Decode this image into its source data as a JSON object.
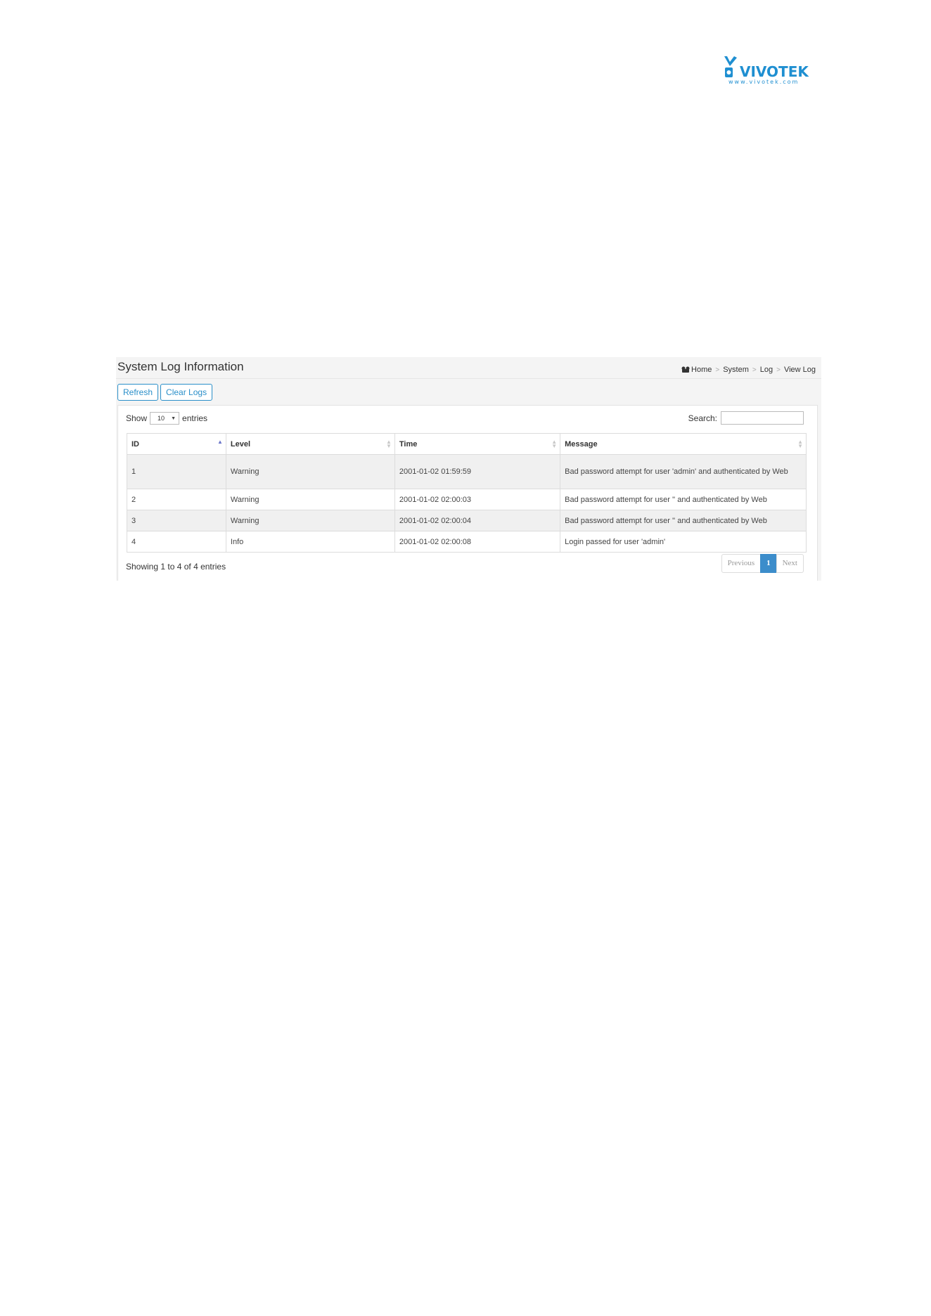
{
  "logo": {
    "brand": "VIVOTEK",
    "url_text": "www.vivotek.com",
    "icon": "vivotek-logo-icon",
    "color": "#1f8fd1"
  },
  "header": {
    "title": "System Log Information",
    "breadcrumb": {
      "home_icon": "home-icon",
      "items": [
        "Home",
        "System",
        "Log",
        "View Log"
      ],
      "separator": ">"
    }
  },
  "toolbar": {
    "refresh_label": "Refresh",
    "clear_label": "Clear Logs"
  },
  "table_controls": {
    "show_label": "Show",
    "page_length": "10",
    "entries_label": "entries",
    "search_label": "Search:",
    "search_value": ""
  },
  "table": {
    "columns": [
      "ID",
      "Level",
      "Time",
      "Message"
    ],
    "rows": [
      {
        "id": "1",
        "level": "Warning",
        "time": "2001-01-02 01:59:59",
        "message": "Bad password attempt for user 'admin' and authenticated by Web"
      },
      {
        "id": "2",
        "level": "Warning",
        "time": "2001-01-02 02:00:03",
        "message": "Bad password attempt for user '' and authenticated by Web"
      },
      {
        "id": "3",
        "level": "Warning",
        "time": "2001-01-02 02:00:04",
        "message": "Bad password attempt for user '' and authenticated by Web"
      },
      {
        "id": "4",
        "level": "Info",
        "time": "2001-01-02 02:00:08",
        "message": "Login passed for user 'admin'"
      }
    ]
  },
  "footer": {
    "info": "Showing 1 to 4 of 4 entries",
    "pagination": {
      "previous": "Previous",
      "current": "1",
      "next": "Next"
    }
  },
  "colors": {
    "accent": "#2a8fc9",
    "active_page": "#3c8dcb",
    "sort_active": "#6a75c9"
  }
}
